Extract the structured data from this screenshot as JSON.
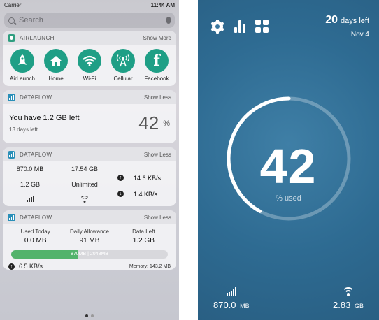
{
  "status_bar": {
    "carrier": "Carrier",
    "time": "11:44 AM"
  },
  "search": {
    "placeholder": "Search"
  },
  "airlaunch": {
    "title": "AIRLAUNCH",
    "action": "Show More",
    "apps": [
      {
        "label": "AirLaunch",
        "icon": "rocket-icon"
      },
      {
        "label": "Home",
        "icon": "home-icon"
      },
      {
        "label": "Wi-Fi",
        "icon": "wifi-icon"
      },
      {
        "label": "Cellular",
        "icon": "cellular-tower-icon"
      },
      {
        "label": "Facebook",
        "icon": "facebook-icon"
      }
    ]
  },
  "dataflow1": {
    "title": "DATAFLOW",
    "action": "Show Less",
    "headline": "You have 1.2 GB left",
    "days": "13 days left",
    "percent": "42",
    "percent_sign": "%"
  },
  "dataflow2": {
    "title": "DATAFLOW",
    "action": "Show Less",
    "cellular_used": "870.0 MB",
    "cellular_left": "1.2 GB",
    "wifi_used": "17.54 GB",
    "wifi_left": "Unlimited",
    "upload": "14.6 KB/s",
    "download": "1.4 KB/s"
  },
  "dataflow3": {
    "title": "DATAFLOW",
    "action": "Show Less",
    "labels": [
      "Used Today",
      "Daily Allowance",
      "Data Left"
    ],
    "values": [
      "0.0 MB",
      "91 MB",
      "1.2 GB"
    ],
    "bar_label": "870MB | 2048MB",
    "bar_fraction": 0.425,
    "speed": "6.5 KB/s",
    "memory": "Memory: 143.2 MB"
  },
  "app": {
    "days_num": "20",
    "days_label": "days left",
    "date": "Nov 4",
    "percent": "42",
    "percent_label": "% used",
    "ring_fraction": 0.42,
    "cell_value": "870.0",
    "cell_unit": "MB",
    "wifi_value": "2.83",
    "wifi_unit": "GB"
  },
  "colors": {
    "accent": "#1f9f86",
    "app_bg": "#2e6b92",
    "bar_fill": "#52b36b"
  }
}
